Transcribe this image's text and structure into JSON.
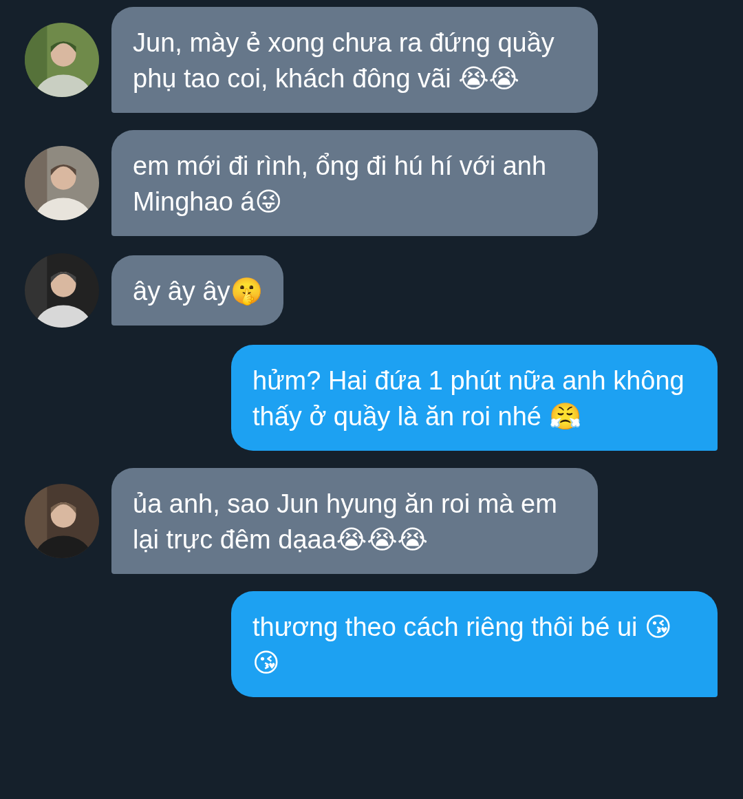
{
  "messages": [
    {
      "kind": "incoming",
      "text": "Jun, mày ẻ xong chưa ra đứng quầy phụ tao coi, khách đông vãi 😭😭"
    },
    {
      "kind": "incoming",
      "text": "em mới đi rình, ổng đi hú hí với anh Minghao á😜"
    },
    {
      "kind": "incoming",
      "text": "ây ây ây🤫"
    },
    {
      "kind": "outgoing",
      "text": "hửm? Hai đứa 1 phút nữa anh không thấy ở quầy là ăn roi nhé 😤"
    },
    {
      "kind": "incoming",
      "text": "ủa anh, sao Jun hyung ăn roi mà em lại trực đêm dạaa😭😭😭"
    },
    {
      "kind": "outgoing",
      "text": "thương theo cách riêng thôi bé ui 😘😘"
    }
  ]
}
